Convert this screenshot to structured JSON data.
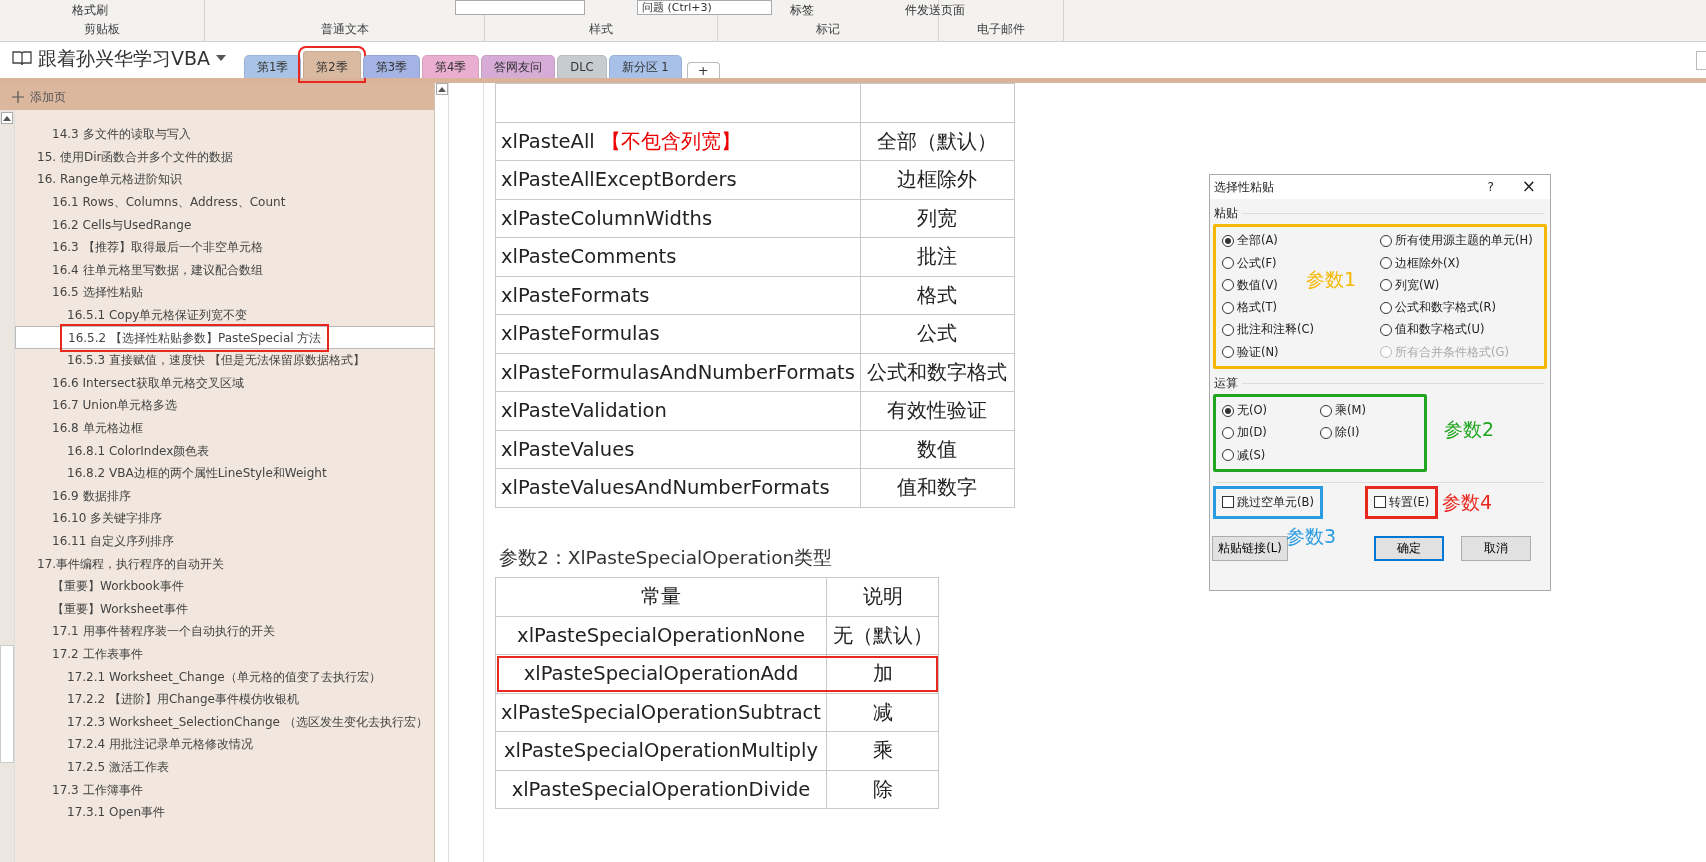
{
  "ribbon": {
    "top_items": [
      {
        "kind": "button",
        "label": "格式刷"
      },
      {
        "kind": "dropdown"
      },
      {
        "kind": "dropdown",
        "label": "问题 (Ctrl+3)"
      },
      {
        "kind": "button",
        "label": "标签"
      },
      {
        "kind": "button",
        "label": "件发送页面"
      }
    ],
    "groups": [
      "剪贴板",
      "普通文本",
      "样式",
      "标记",
      "电子邮件"
    ]
  },
  "notebook": {
    "title": "跟着孙兴华学习VBA"
  },
  "tabs": [
    {
      "label": "第1季",
      "selected": false,
      "highlighted": false,
      "color": "#a9c3e6"
    },
    {
      "label": "第2季",
      "selected": true,
      "highlighted": true,
      "color": "#d9b9a0"
    },
    {
      "label": "第3季",
      "selected": false,
      "highlighted": false,
      "color": "#a3b3e3"
    },
    {
      "label": "第4季",
      "selected": false,
      "highlighted": false,
      "color": "#eaaed0"
    },
    {
      "label": "答网友问",
      "selected": false,
      "highlighted": false,
      "color": "#d6abd6"
    },
    {
      "label": "DLC",
      "selected": false,
      "highlighted": false,
      "color": "#c7ccd1"
    },
    {
      "label": "新分区 1",
      "selected": false,
      "highlighted": false,
      "color": "#a8c1e8"
    }
  ],
  "add_tab": "+",
  "sidebar": {
    "add_page": "添加页",
    "continued_items": [
      {
        "label": "14.3 多文件的读取与写入",
        "selected": false,
        "highlighted": false
      }
    ],
    "items": [
      {
        "label": "15. 使用Dir函数合并多个文件的数据",
        "selected": false,
        "highlighted": false
      },
      {
        "label": "16. Range单元格进阶知识",
        "selected": false,
        "highlighted": false,
        "children": [
          {
            "label": "16.1 Rows、Columns、Address、Count",
            "selected": false,
            "highlighted": false
          },
          {
            "label": "16.2 Cells与UsedRange",
            "selected": false,
            "highlighted": false
          },
          {
            "label": "16.3 【推荐】取得最后一个非空单元格",
            "selected": false,
            "highlighted": false
          },
          {
            "label": "16.4 往单元格里写数据，建议配合数组",
            "selected": false,
            "highlighted": false
          },
          {
            "label": "16.5 选择性粘贴",
            "selected": false,
            "highlighted": false,
            "children": [
              {
                "label": "16.5.1 Copy单元格保证列宽不变",
                "selected": false,
                "highlighted": false
              },
              {
                "label": "16.5.2 【选择性粘贴参数】PasteSpecial 方法",
                "selected": true,
                "highlighted": true
              },
              {
                "label": "16.5.3 直接赋值，速度快 【但是无法保留原数据格式】",
                "selected": false,
                "highlighted": false
              }
            ]
          },
          {
            "label": "16.6 Intersect获取单元格交叉区域",
            "selected": false,
            "highlighted": false
          },
          {
            "label": "16.7 Union单元格多选",
            "selected": false,
            "highlighted": false
          },
          {
            "label": "16.8 单元格边框",
            "selected": false,
            "highlighted": false,
            "children": [
              {
                "label": "16.8.1 ColorIndex颜色表",
                "selected": false,
                "highlighted": false
              },
              {
                "label": "16.8.2 VBA边框的两个属性LineStyle和Weight",
                "selected": false,
                "highlighted": false
              }
            ]
          },
          {
            "label": "16.9 数据排序",
            "selected": false,
            "highlighted": false
          },
          {
            "label": "16.10 多关键字排序",
            "selected": false,
            "highlighted": false
          },
          {
            "label": "16.11 自定义序列排序",
            "selected": false,
            "highlighted": false
          }
        ]
      },
      {
        "label": "17.事件编程，执行程序的自动开关",
        "selected": false,
        "highlighted": false,
        "children": [
          {
            "label": "【重要】Workbook事件",
            "selected": false,
            "highlighted": false
          },
          {
            "label": "【重要】Worksheet事件",
            "selected": false,
            "highlighted": false
          },
          {
            "label": "17.1 用事件替程序装一个自动执行的开关",
            "selected": false,
            "highlighted": false
          },
          {
            "label": "17.2 工作表事件",
            "selected": false,
            "highlighted": false,
            "children": [
              {
                "label": "17.2.1 Worksheet_Change（单元格的值变了去执行宏）",
                "selected": false,
                "highlighted": false
              },
              {
                "label": "17.2.2 【进阶】用Change事件模仿收银机",
                "selected": false,
                "highlighted": false
              },
              {
                "label": "17.2.3 Worksheet_SelectionChange （选区发生变化去执行宏）",
                "selected": false,
                "highlighted": false
              },
              {
                "label": "17.2.4 用批注记录单元格修改情况",
                "selected": false,
                "highlighted": false
              },
              {
                "label": "17.2.5 激活工作表",
                "selected": false,
                "highlighted": false
              }
            ]
          },
          {
            "label": "17.3 工作簿事件",
            "selected": false,
            "highlighted": false,
            "children": [
              {
                "label": "17.3.1 Open事件",
                "selected": false,
                "highlighted": false
              }
            ]
          }
        ]
      }
    ]
  },
  "paste_table": {
    "rows": [
      {
        "constant": "xlPasteAll",
        "note": "【不包含列宽】",
        "description": "全部（默认）"
      },
      {
        "constant": "xlPasteAllExceptBorders",
        "description": "边框除外"
      },
      {
        "constant": "xlPasteColumnWidths",
        "description": "列宽"
      },
      {
        "constant": "xlPasteComments",
        "description": "批注"
      },
      {
        "constant": "xlPasteFormats",
        "description": "格式"
      },
      {
        "constant": "xlPasteFormulas",
        "description": "公式"
      },
      {
        "constant": "xlPasteFormulasAndNumberFormats",
        "description": "公式和数字格式"
      },
      {
        "constant": "xlPasteValidation",
        "description": "有效性验证"
      },
      {
        "constant": "xlPasteValues",
        "description": "数值"
      },
      {
        "constant": "xlPasteValuesAndNumberFormats",
        "description": "值和数字"
      }
    ]
  },
  "operation_heading": "参数2：XlPasteSpecialOperation类型",
  "operation_table": {
    "columns": [
      "常量",
      "说明"
    ],
    "rows": [
      {
        "constant": "xlPasteSpecialOperationNone",
        "description": "无（默认）",
        "highlighted": false
      },
      {
        "constant": "xlPasteSpecialOperationAdd",
        "description": "加",
        "highlighted": true
      },
      {
        "constant": "xlPasteSpecialOperationSubtract",
        "description": "减",
        "highlighted": false
      },
      {
        "constant": "xlPasteSpecialOperationMultiply",
        "description": "乘",
        "highlighted": false
      },
      {
        "constant": "xlPasteSpecialOperationDivide",
        "description": "除",
        "highlighted": false
      }
    ]
  },
  "dialog": {
    "title": "选择性粘贴",
    "help": "?",
    "close": "×",
    "paste_group": {
      "title": "粘贴",
      "annotation": "参数1",
      "color": "#f5b800",
      "options": [
        {
          "label": "全部(A)",
          "selected": true,
          "disabled": false
        },
        {
          "label": "所有使用源主题的单元(H)",
          "selected": false,
          "disabled": false
        },
        {
          "label": "公式(F)",
          "selected": false,
          "disabled": false
        },
        {
          "label": "边框除外(X)",
          "selected": false,
          "disabled": false
        },
        {
          "label": "数值(V)",
          "selected": false,
          "disabled": false
        },
        {
          "label": "列宽(W)",
          "selected": false,
          "disabled": false
        },
        {
          "label": "格式(T)",
          "selected": false,
          "disabled": false
        },
        {
          "label": "公式和数字格式(R)",
          "selected": false,
          "disabled": false
        },
        {
          "label": "批注和注释(C)",
          "selected": false,
          "disabled": false
        },
        {
          "label": "值和数字格式(U)",
          "selected": false,
          "disabled": false
        },
        {
          "label": "验证(N)",
          "selected": false,
          "disabled": false
        },
        {
          "label": "所有合并条件格式(G)",
          "selected": false,
          "disabled": true
        }
      ]
    },
    "operation_group": {
      "title": "运算",
      "annotation": "参数2",
      "color": "#1fa51f",
      "options": [
        {
          "label": "无(O)",
          "selected": true,
          "disabled": false
        },
        {
          "label": "乘(M)",
          "selected": false,
          "disabled": false
        },
        {
          "label": "加(D)",
          "selected": false,
          "disabled": false
        },
        {
          "label": "除(I)",
          "selected": false,
          "disabled": false
        },
        {
          "label": "减(S)",
          "selected": false,
          "disabled": false
        }
      ]
    },
    "checkboxes": [
      {
        "label": "跳过空单元(B)",
        "checked": false,
        "annotation": "参数3",
        "color": "#2a9be0"
      },
      {
        "label": "转置(E)",
        "checked": false,
        "annotation": "参数4",
        "color": "#e8281e"
      }
    ],
    "buttons": [
      {
        "label": "粘贴链接(L)",
        "default": false
      },
      {
        "label": "确定",
        "default": true
      },
      {
        "label": "取消",
        "default": false
      }
    ]
  }
}
